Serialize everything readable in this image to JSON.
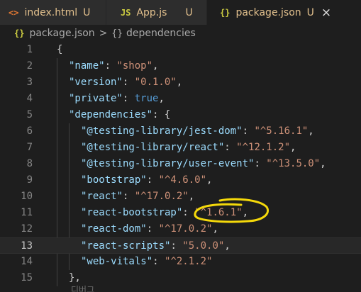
{
  "tabs": [
    {
      "icon": "<>",
      "name": "index.html",
      "status": "U",
      "active": false
    },
    {
      "icon": "JS",
      "name": "App.js",
      "status": "U",
      "active": false
    },
    {
      "icon": "{}",
      "name": "package.json",
      "status": "U",
      "active": true,
      "close": "×"
    }
  ],
  "breadcrumb": {
    "file_icon": "{}",
    "file": "package.json",
    "separator": ">",
    "object_icon": "{}",
    "symbol": "dependencies"
  },
  "editor": {
    "current_line": 13,
    "lines": [
      {
        "n": "1",
        "parts": [
          [
            "punc",
            "{"
          ]
        ]
      },
      {
        "n": "2",
        "parts": [
          [
            "key",
            "\"name\""
          ],
          [
            "punc",
            ": "
          ],
          [
            "str",
            "\"shop\""
          ],
          [
            "punc",
            ","
          ]
        ]
      },
      {
        "n": "3",
        "parts": [
          [
            "key",
            "\"version\""
          ],
          [
            "punc",
            ": "
          ],
          [
            "str",
            "\"0.1.0\""
          ],
          [
            "punc",
            ","
          ]
        ]
      },
      {
        "n": "4",
        "parts": [
          [
            "key",
            "\"private\""
          ],
          [
            "punc",
            ": "
          ],
          [
            "kw",
            "true"
          ],
          [
            "punc",
            ","
          ]
        ]
      },
      {
        "n": "5",
        "parts": [
          [
            "key",
            "\"dependencies\""
          ],
          [
            "punc",
            ": {"
          ]
        ]
      },
      {
        "n": "6",
        "parts": [
          [
            "key",
            "\"@testing-library/jest-dom\""
          ],
          [
            "punc",
            ": "
          ],
          [
            "str",
            "\"^5.16.1\""
          ],
          [
            "punc",
            ","
          ]
        ]
      },
      {
        "n": "7",
        "parts": [
          [
            "key",
            "\"@testing-library/react\""
          ],
          [
            "punc",
            ": "
          ],
          [
            "str",
            "\"^12.1.2\""
          ],
          [
            "punc",
            ","
          ]
        ]
      },
      {
        "n": "8",
        "parts": [
          [
            "key",
            "\"@testing-library/user-event\""
          ],
          [
            "punc",
            ": "
          ],
          [
            "str",
            "\"^13.5.0\""
          ],
          [
            "punc",
            ","
          ]
        ]
      },
      {
        "n": "9",
        "parts": [
          [
            "key",
            "\"bootstrap\""
          ],
          [
            "punc",
            ": "
          ],
          [
            "str",
            "\"^4.6.0\""
          ],
          [
            "punc",
            ","
          ]
        ]
      },
      {
        "n": "10",
        "parts": [
          [
            "key",
            "\"react\""
          ],
          [
            "punc",
            ": "
          ],
          [
            "str",
            "\"^17.0.2\""
          ],
          [
            "punc",
            ","
          ]
        ]
      },
      {
        "n": "11",
        "parts": [
          [
            "key",
            "\"react-bootstrap\""
          ],
          [
            "punc",
            ": "
          ],
          [
            "str",
            "\"^1.6.1\""
          ],
          [
            "punc",
            ","
          ]
        ]
      },
      {
        "n": "12",
        "parts": [
          [
            "key",
            "\"react-dom\""
          ],
          [
            "punc",
            ": "
          ],
          [
            "str",
            "\"^17.0.2\""
          ],
          [
            "punc",
            ","
          ]
        ]
      },
      {
        "n": "13",
        "parts": [
          [
            "key",
            "\"react-scripts\""
          ],
          [
            "punc",
            ": "
          ],
          [
            "str",
            "\"5.0.0\""
          ],
          [
            "punc",
            ","
          ]
        ]
      },
      {
        "n": "14",
        "parts": [
          [
            "key",
            "\"web-vitals\""
          ],
          [
            "punc",
            ": "
          ],
          [
            "str",
            "\"^2.1.2\""
          ]
        ]
      },
      {
        "n": "15",
        "parts": [
          [
            "punc",
            "},"
          ]
        ]
      }
    ],
    "faded_text": "디버그"
  },
  "colors": {
    "background": "#1e1e1e",
    "key": "#9cdcfe",
    "string": "#ce9178",
    "keyword": "#569cd6",
    "modified": "#e2c08d",
    "annotation": "#f5d90a"
  }
}
